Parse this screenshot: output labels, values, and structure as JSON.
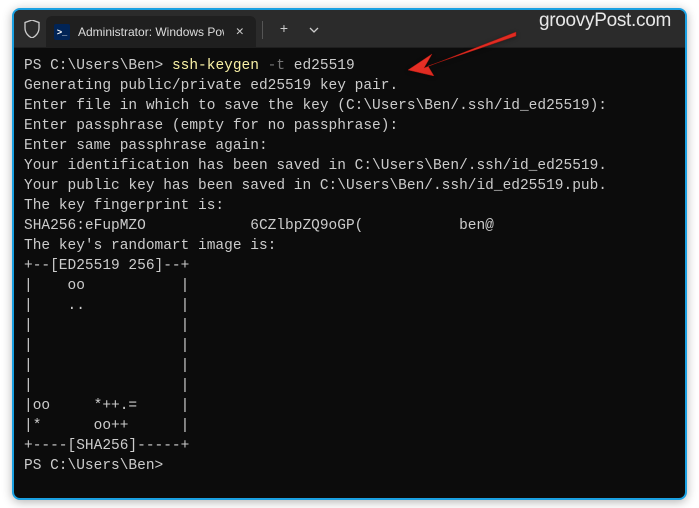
{
  "window": {
    "tab_title": "Administrator: Windows Powe",
    "watermark": "groovyPost.com"
  },
  "terminal": {
    "prompt1_prefix": "PS C:\\Users\\Ben> ",
    "cmd": "ssh-keygen ",
    "flag": "-t",
    "arg": " ed25519",
    "l1": "Generating public/private ed25519 key pair.",
    "l2": "Enter file in which to save the key (C:\\Users\\Ben/.ssh/id_ed25519):",
    "l3": "Enter passphrase (empty for no passphrase):",
    "l4": "Enter same passphrase again:",
    "l5": "Your identification has been saved in C:\\Users\\Ben/.ssh/id_ed25519.",
    "l6": "Your public key has been saved in C:\\Users\\Ben/.ssh/id_ed25519.pub.",
    "l7": "The key fingerprint is:",
    "l8": "SHA256:eFupMZO            6CZlbpZQ9oGP(           ben@",
    "l9": "The key's randomart image is:",
    "art0": "+--[ED25519 256]--+",
    "art1": "|    oo           |",
    "art2": "|    ..           |",
    "art3": "|                 |",
    "art4": "|                 |",
    "art5": "|                 |",
    "art6": "|                 |",
    "art7": "|oo     *++.=     |",
    "art8": "|*      oo++      |",
    "art9": "+----[SHA256]-----+",
    "prompt2": "PS C:\\Users\\Ben>"
  }
}
